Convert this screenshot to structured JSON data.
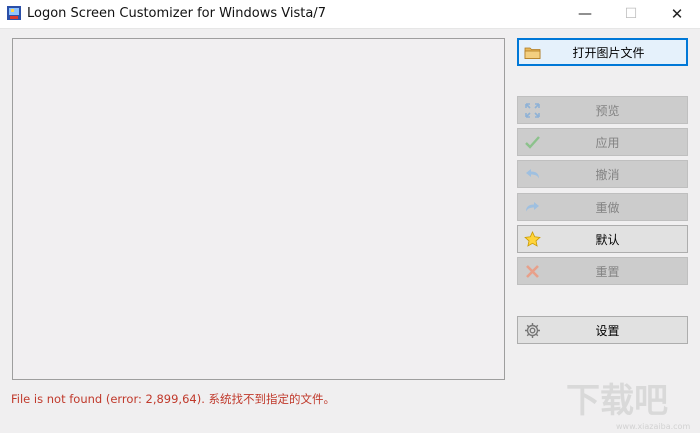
{
  "window": {
    "title": "Logon Screen Customizer for Windows Vista/7",
    "controls": {
      "minimize": "—",
      "maximize": "☐",
      "close": "✕"
    }
  },
  "buttons": {
    "open": "打开图片文件",
    "preview": "预览",
    "apply": "应用",
    "undo": "撤消",
    "redo": "重做",
    "default": "默认",
    "reset": "重置",
    "settings": "设置"
  },
  "status": {
    "message": "File is not found (error: 2,899,64). 系统找不到指定的文件。",
    "color": "#c0392b"
  },
  "watermark": {
    "text": "下载吧",
    "url": "www.xiazaiba.com"
  },
  "colors": {
    "accent": "#0078d7",
    "disabled_text": "#838383"
  }
}
